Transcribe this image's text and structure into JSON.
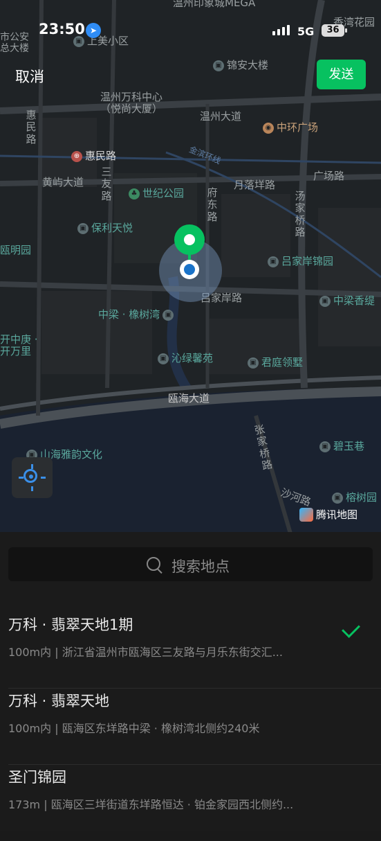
{
  "status_bar": {
    "time": "23:50",
    "network": "5G",
    "battery": "36"
  },
  "header": {
    "cancel_label": "取消",
    "send_label": "发送"
  },
  "map": {
    "labels": {
      "yinxiang": "温州印象城MEGA",
      "gongan": "市公安\n总大楼",
      "shangmei": "上美小区",
      "xiangtai": "香湾花园",
      "jinan": "锦安大楼",
      "wanke": "温州万科中心\n（悦尚大厦）",
      "wenzhou_dadao": "温州大道",
      "zhonghuan": "中环广场",
      "huimin_v": "惠民路",
      "huimin": "惠民路",
      "jinbin": "金滨环线",
      "huangyu": "黄屿大道",
      "sanyou": "三友路",
      "shiji": "世纪公园",
      "yueluo": "月落垟路",
      "guangchang": "广场路",
      "fudong": "府东路",
      "tangjia": "汤家桥路",
      "baoli": "保利天悦",
      "mingyuan": "瓯明园",
      "lvjia_jinxiu": "吕家岸锦园",
      "lvjia_road": "吕家岸路",
      "zhongliang_xiang": "中梁香缇",
      "zhongliang_xiangshu": "中梁 · 橡树湾",
      "kaizhong": "开中庚 ·\n开万里",
      "qinlv": "沁绿馨苑",
      "junting": "君庭领墅",
      "ouhai": "瓯海大道",
      "zhangjia": "张家桥路",
      "biyu": "碧玉巷",
      "shanhai": "山海雅韵文化",
      "shahe": "沙河路",
      "ronghua": "榕树园"
    }
  },
  "brand": {
    "name": "腾讯地图"
  },
  "search": {
    "placeholder": "搜索地点"
  },
  "results": [
    {
      "name": "万科 · 翡翠天地1期",
      "address": "100m内 | 浙江省温州市瓯海区三友路与月乐东街交汇...",
      "selected": true
    },
    {
      "name": "万科 · 翡翠天地",
      "address": "100m内 | 瓯海区东垟路中梁 · 橡树湾北侧约240米",
      "selected": false
    },
    {
      "name": "圣门锦园",
      "address": "173m | 瓯海区三垟街道东垟路恒达 · 铂金家园西北侧约...",
      "selected": false
    }
  ],
  "colors": {
    "accent": "#07c160",
    "location_blue": "#1a73c9",
    "map_bg": "#1f2326"
  }
}
